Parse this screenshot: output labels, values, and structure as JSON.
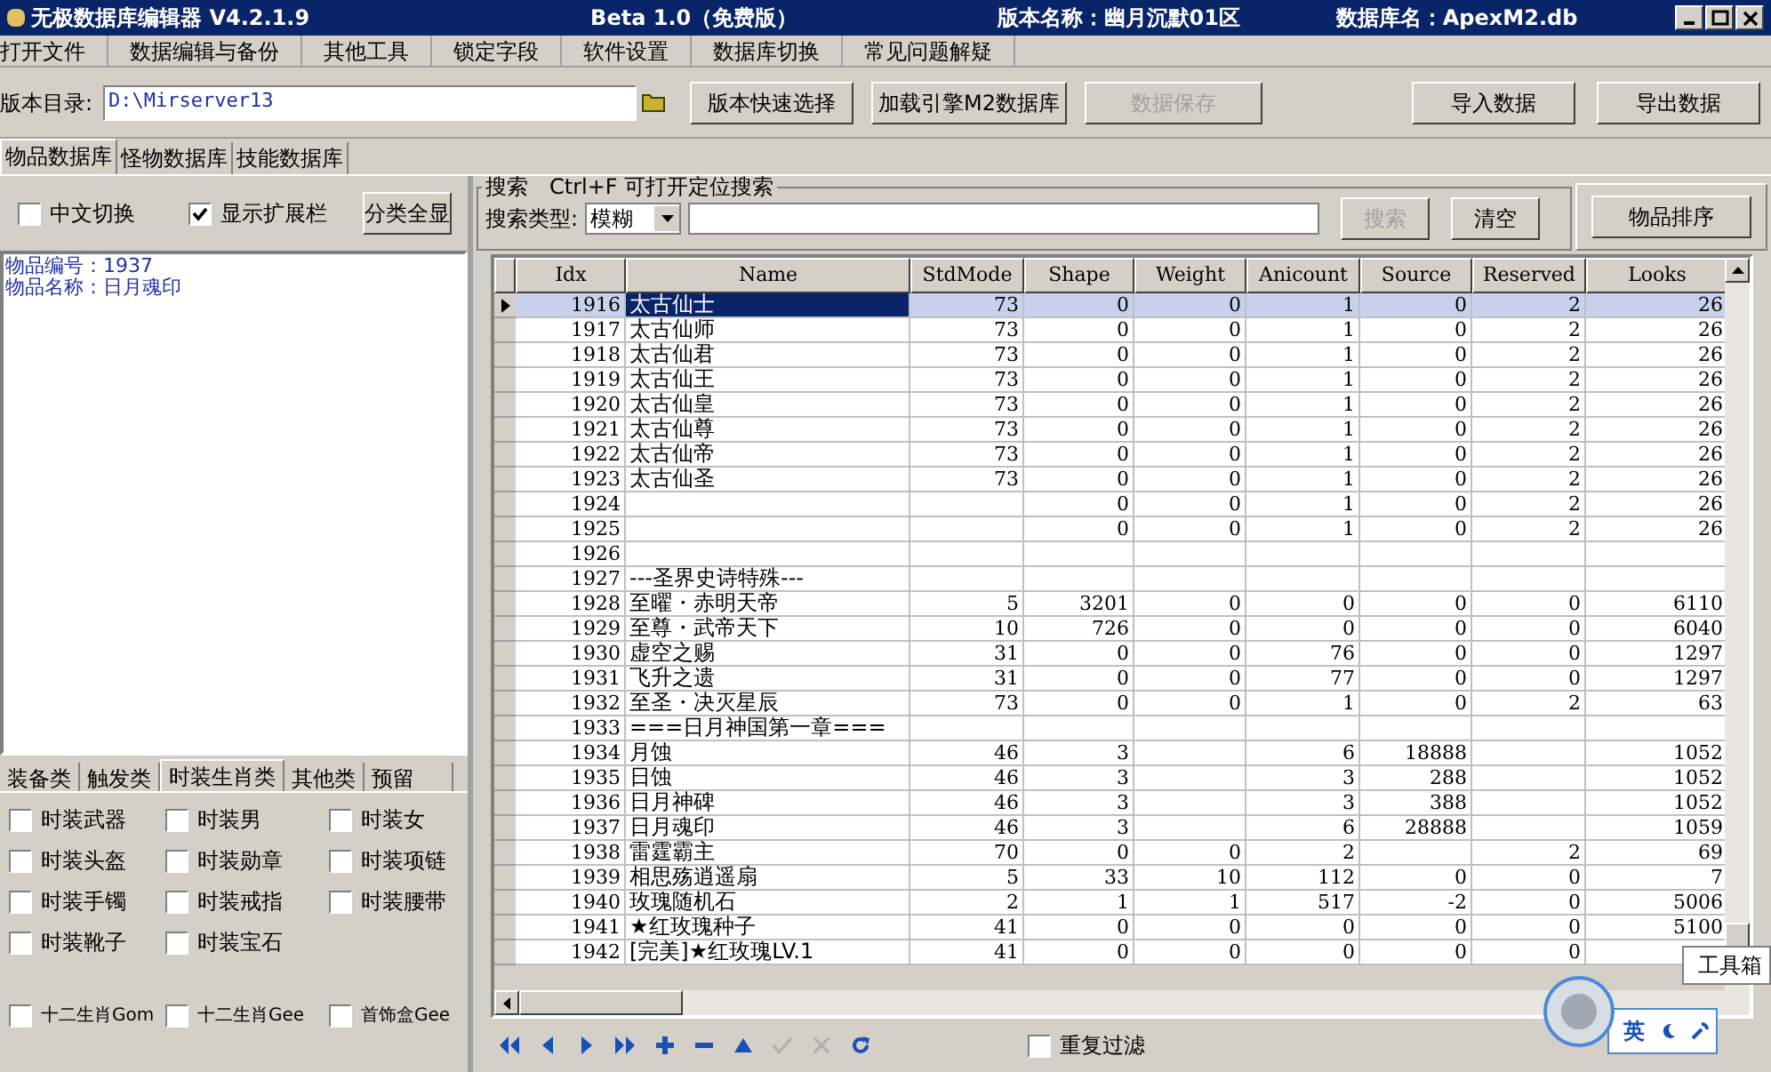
{
  "window": {
    "title_parts": [
      "无极数据库编辑器 V4.2.1.9",
      "Beta 1.0（免费版）",
      "版本名称：幽月沉默01区",
      "数据库名：ApexM2.db"
    ]
  },
  "menu": [
    "打开文件",
    "数据编辑与备份",
    "其他工具",
    "锁定字段",
    "软件设置",
    "数据库切换",
    "常见问题解疑"
  ],
  "toolbar": {
    "dir_label": "版本目录:",
    "dir_value": "D:\\Mirserver13",
    "buttons": [
      {
        "label": "版本快速选择",
        "disabled": false
      },
      {
        "label": "加载引擎M2数据库",
        "disabled": false
      },
      {
        "label": "数据保存",
        "disabled": true
      }
    ],
    "right_buttons": [
      {
        "label": "导入数据",
        "disabled": false
      },
      {
        "label": "导出数据",
        "disabled": false
      }
    ]
  },
  "tabs": [
    {
      "label": "物品数据库",
      "selected": true
    },
    {
      "label": "怪物数据库",
      "selected": false
    },
    {
      "label": "技能数据库",
      "selected": false
    }
  ],
  "left": {
    "options": [
      {
        "label": "中文切换",
        "checked": false
      },
      {
        "label": "显示扩展栏",
        "checked": true
      }
    ],
    "show_all_button": "分类全显",
    "info": [
      "物品编号：1937",
      "物品名称：日月魂印"
    ],
    "category_tabs": [
      {
        "label": "装备类",
        "selected": false
      },
      {
        "label": "触发类",
        "selected": false
      },
      {
        "label": "时装生肖类",
        "selected": true
      },
      {
        "label": "其他类",
        "selected": false
      },
      {
        "label": "预留",
        "selected": false
      }
    ],
    "category_checks": [
      {
        "label": "时装武器",
        "checked": false
      },
      {
        "label": "时装男",
        "checked": false
      },
      {
        "label": "时装女",
        "checked": false
      },
      {
        "label": "时装头盔",
        "checked": false
      },
      {
        "label": "时装勋章",
        "checked": false
      },
      {
        "label": "时装项链",
        "checked": false
      },
      {
        "label": "时装手镯",
        "checked": false
      },
      {
        "label": "时装戒指",
        "checked": false
      },
      {
        "label": "时装腰带",
        "checked": false
      },
      {
        "label": "时装靴子",
        "checked": false
      },
      {
        "label": "时装宝石",
        "checked": false
      }
    ],
    "bottom_checks": [
      {
        "label": "十二生肖Gom",
        "checked": false
      },
      {
        "label": "十二生肖Gee",
        "checked": false
      },
      {
        "label": "首饰盒Gee",
        "checked": false
      }
    ]
  },
  "search": {
    "legend": "搜索　Ctrl+F 可打开定位搜索",
    "type_label": "搜索类型:",
    "type_value": "模糊",
    "buttons": [
      {
        "label": "搜索",
        "disabled": true
      },
      {
        "label": "清空",
        "disabled": false
      }
    ],
    "sort_button": "物品排序"
  },
  "table": {
    "columns": [
      "Idx",
      "Name",
      "StdMode",
      "Shape",
      "Weight",
      "Anicount",
      "Source",
      "Reserved",
      "Looks"
    ],
    "rows": [
      {
        "selected": true,
        "idx": "1916",
        "name": "太古仙士",
        "stdmode": "73",
        "shape": "0",
        "weight": "0",
        "anicount": "1",
        "source": "0",
        "reserved": "2",
        "looks": "26"
      },
      {
        "selected": false,
        "idx": "1917",
        "name": "太古仙师",
        "stdmode": "73",
        "shape": "0",
        "weight": "0",
        "anicount": "1",
        "source": "0",
        "reserved": "2",
        "looks": "26"
      },
      {
        "selected": false,
        "idx": "1918",
        "name": "太古仙君",
        "stdmode": "73",
        "shape": "0",
        "weight": "0",
        "anicount": "1",
        "source": "0",
        "reserved": "2",
        "looks": "26"
      },
      {
        "selected": false,
        "idx": "1919",
        "name": "太古仙王",
        "stdmode": "73",
        "shape": "0",
        "weight": "0",
        "anicount": "1",
        "source": "0",
        "reserved": "2",
        "looks": "26"
      },
      {
        "selected": false,
        "idx": "1920",
        "name": "太古仙皇",
        "stdmode": "73",
        "shape": "0",
        "weight": "0",
        "anicount": "1",
        "source": "0",
        "reserved": "2",
        "looks": "26"
      },
      {
        "selected": false,
        "idx": "1921",
        "name": "太古仙尊",
        "stdmode": "73",
        "shape": "0",
        "weight": "0",
        "anicount": "1",
        "source": "0",
        "reserved": "2",
        "looks": "26"
      },
      {
        "selected": false,
        "idx": "1922",
        "name": "太古仙帝",
        "stdmode": "73",
        "shape": "0",
        "weight": "0",
        "anicount": "1",
        "source": "0",
        "reserved": "2",
        "looks": "26"
      },
      {
        "selected": false,
        "idx": "1923",
        "name": "太古仙圣",
        "stdmode": "73",
        "shape": "0",
        "weight": "0",
        "anicount": "1",
        "source": "0",
        "reserved": "2",
        "looks": "26"
      },
      {
        "selected": false,
        "idx": "1924",
        "shape": "0",
        "weight": "0",
        "anicount": "1",
        "source": "0",
        "reserved": "2",
        "looks": "26"
      },
      {
        "selected": false,
        "idx": "1925",
        "shape": "0",
        "weight": "0",
        "anicount": "1",
        "source": "0",
        "reserved": "2",
        "looks": "26"
      },
      {
        "selected": false,
        "idx": "1926"
      },
      {
        "selected": false,
        "idx": "1927",
        "name": "---圣界史诗特殊---"
      },
      {
        "selected": false,
        "idx": "1928",
        "name": "至曜・赤明天帝",
        "stdmode": "5",
        "shape": "3201",
        "weight": "0",
        "anicount": "0",
        "source": "0",
        "reserved": "0",
        "looks": "6110"
      },
      {
        "selected": false,
        "idx": "1929",
        "name": "至尊・武帝天下",
        "stdmode": "10",
        "shape": "726",
        "weight": "0",
        "anicount": "0",
        "source": "0",
        "reserved": "0",
        "looks": "6040"
      },
      {
        "selected": false,
        "idx": "1930",
        "name": "虚空之赐",
        "stdmode": "31",
        "shape": "0",
        "weight": "0",
        "anicount": "76",
        "source": "0",
        "reserved": "0",
        "looks": "1297"
      },
      {
        "selected": false,
        "idx": "1931",
        "name": "飞升之遗",
        "stdmode": "31",
        "shape": "0",
        "weight": "0",
        "anicount": "77",
        "source": "0",
        "reserved": "0",
        "looks": "1297"
      },
      {
        "selected": false,
        "idx": "1932",
        "name": "至圣・决灭星辰",
        "stdmode": "73",
        "shape": "0",
        "weight": "0",
        "anicount": "1",
        "source": "0",
        "reserved": "2",
        "looks": "63"
      },
      {
        "selected": false,
        "idx": "1933",
        "name": "===日月神国第一章==="
      },
      {
        "selected": false,
        "idx": "1934",
        "name": "月蚀",
        "stdmode": "46",
        "shape": "3",
        "anicount": "6",
        "source": "18888",
        "looks": "1052"
      },
      {
        "selected": false,
        "idx": "1935",
        "name": "日蚀",
        "stdmode": "46",
        "shape": "3",
        "anicount": "3",
        "source": "288",
        "looks": "1052"
      },
      {
        "selected": false,
        "idx": "1936",
        "name": "日月神碑",
        "stdmode": "46",
        "shape": "3",
        "anicount": "3",
        "source": "388",
        "looks": "1052"
      },
      {
        "selected": false,
        "idx": "1937",
        "name": "日月魂印",
        "stdmode": "46",
        "shape": "3",
        "anicount": "6",
        "source": "28888",
        "looks": "1059"
      },
      {
        "selected": false,
        "idx": "1938",
        "name": "雷霆霸主",
        "stdmode": "70",
        "shape": "0",
        "weight": "0",
        "anicount": "2",
        "reserved": "2",
        "looks": "69"
      },
      {
        "selected": false,
        "idx": "1939",
        "name": "相思殇逍遥扇",
        "stdmode": "5",
        "shape": "33",
        "weight": "10",
        "anicount": "112",
        "source": "0",
        "reserved": "0",
        "looks": "7"
      },
      {
        "selected": false,
        "idx": "1940",
        "name": "玫瑰随机石",
        "stdmode": "2",
        "shape": "1",
        "weight": "1",
        "anicount": "517",
        "source": "-2",
        "reserved": "0",
        "looks": "5006"
      },
      {
        "selected": false,
        "idx": "1941",
        "name": "★红玫瑰种子",
        "stdmode": "41",
        "shape": "0",
        "weight": "0",
        "anicount": "0",
        "source": "0",
        "reserved": "0",
        "looks": "5100"
      },
      {
        "selected": false,
        "idx": "1942",
        "name": "[完美]★红玫瑰LV.1",
        "stdmode": "41",
        "shape": "0",
        "weight": "0",
        "anicount": "0",
        "source": "0",
        "reserved": "0"
      }
    ]
  },
  "navigator": [
    {
      "kind": "first",
      "disabled": false
    },
    {
      "kind": "prior",
      "disabled": false
    },
    {
      "kind": "next",
      "disabled": false
    },
    {
      "kind": "last",
      "disabled": false
    },
    {
      "kind": "insert",
      "disabled": false
    },
    {
      "kind": "delete",
      "disabled": false
    },
    {
      "kind": "edit",
      "disabled": false
    },
    {
      "kind": "post",
      "disabled": true
    },
    {
      "kind": "cancel",
      "disabled": true
    },
    {
      "kind": "refresh",
      "disabled": false
    }
  ],
  "dedupe_filter": {
    "label": "重复过滤",
    "checked": false
  },
  "ime_bar": {
    "mode": "英"
  },
  "tooltip": "工具箱"
}
